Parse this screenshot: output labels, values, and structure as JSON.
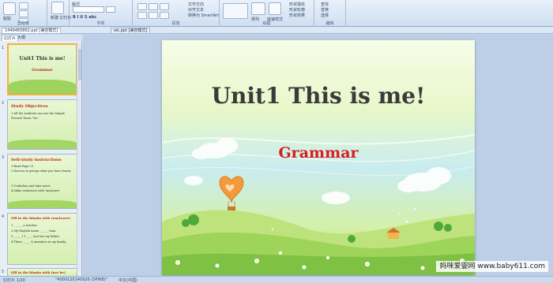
{
  "ribbon": {
    "groups": [
      {
        "label": "剪贴板"
      },
      {
        "label": "字体"
      },
      {
        "label": "段落"
      },
      {
        "label": "绘图"
      },
      {
        "label": "编辑"
      }
    ],
    "paste_label": "粘贴",
    "new_slide_label": "新建\n幻灯片",
    "layout_label": "版式",
    "reset_label": "重设",
    "delete_label": "删除",
    "text_direction_label": "文字方向",
    "align_text_label": "对齐文本",
    "smartart_label": "转换为 SmartArt",
    "arrange_label": "排列",
    "quick_styles_label": "快速样式",
    "shape_fill_label": "形状填充",
    "shape_outline_label": "形状轮廓",
    "shape_effects_label": "形状效果",
    "find_label": "查找",
    "replace_label": "替换",
    "select_label": "选择"
  },
  "doctabs": [
    {
      "label": "1449465862.ppt [兼容模式]"
    },
    {
      "label": "wk.ppt [兼容模式]"
    }
  ],
  "panel": {
    "tab_slides": "幻灯片",
    "tab_outline": "大纲"
  },
  "thumbs": [
    {
      "num": "1",
      "title": "Unit1 This is me!",
      "sub": "Grammar"
    },
    {
      "num": "2",
      "title": "Study Objectives",
      "line1": "1.All the students can use the Simple",
      "line2": "Present Tense \"be\"."
    },
    {
      "num": "3",
      "title": "Self-study instructions",
      "line1": "1.Read Page 11.",
      "line2": "2.Discuss in groups what you have learnt.",
      "line3": "3.Underline and take notes",
      "line4": "4.Make sentences with 'am/is/are'"
    },
    {
      "num": "4",
      "title": "Fill in the blanks with (am/is/are)",
      "line1": "1 ______ a teacher.",
      "line2": "2 My English name ______ Sam.",
      "line3": "3 _____ I 1 ____ (not be) my father.",
      "line4": "4 There _____ 4 members in my family."
    },
    {
      "num": "5",
      "title": "Fill in the blanks with (ner be)"
    }
  ],
  "slide": {
    "title": "Unit1 This is me!",
    "subtitle": "Grammar"
  },
  "status": {
    "slide_info": "幻灯片 1/20",
    "theme": "\"4000120140926 (SPWB)\"",
    "language": "中文(中国)"
  },
  "watermark": "妈咪爱婴网 www.baby611.com"
}
